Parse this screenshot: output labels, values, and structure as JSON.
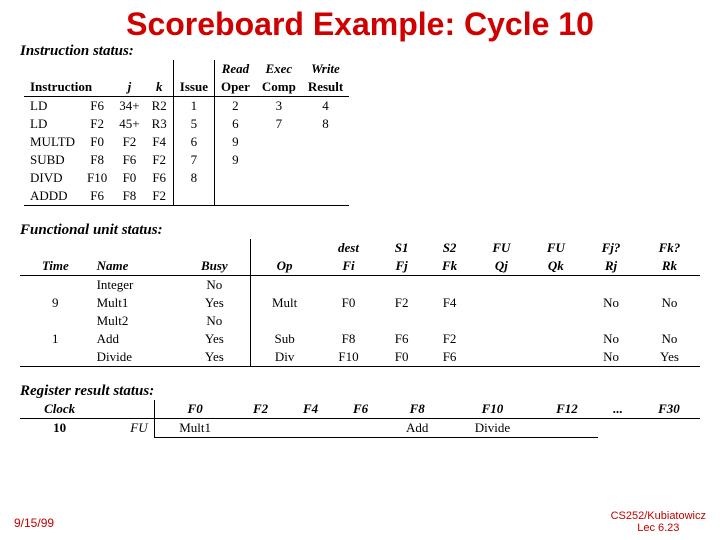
{
  "title": "Scoreboard Example: Cycle 10",
  "sections": {
    "instr": "Instruction status:",
    "fu": "Functional unit status:",
    "reg": "Register result status:"
  },
  "instr_headers": {
    "instruction": "Instruction",
    "j": "j",
    "k": "k",
    "issue": "Issue",
    "read": "Read",
    "oper": "Oper",
    "exec": "Exec",
    "comp": "Comp",
    "write": "Write",
    "result": "Result"
  },
  "instr_rows": [
    {
      "op": "LD",
      "dest": "F6",
      "j": "34+",
      "k": "R2",
      "issue": "1",
      "read": "2",
      "exec": "3",
      "write": "4"
    },
    {
      "op": "LD",
      "dest": "F2",
      "j": "45+",
      "k": "R3",
      "issue": "5",
      "read": "6",
      "exec": "7",
      "write": "8"
    },
    {
      "op": "MULTD",
      "dest": "F0",
      "j": "F2",
      "k": "F4",
      "issue": "6",
      "read": "9",
      "exec": "",
      "write": ""
    },
    {
      "op": "SUBD",
      "dest": "F8",
      "j": "F6",
      "k": "F2",
      "issue": "7",
      "read": "9",
      "exec": "",
      "write": ""
    },
    {
      "op": "DIVD",
      "dest": "F10",
      "j": "F0",
      "k": "F6",
      "issue": "8",
      "read": "",
      "exec": "",
      "write": ""
    },
    {
      "op": "ADDD",
      "dest": "F6",
      "j": "F8",
      "k": "F2",
      "issue": "",
      "read": "",
      "exec": "",
      "write": ""
    }
  ],
  "fu_headers": {
    "time": "Time",
    "name": "Name",
    "busy": "Busy",
    "op": "Op",
    "dest": "dest",
    "fi": "Fi",
    "s1": "S1",
    "fj": "Fj",
    "s2": "S2",
    "fk": "Fk",
    "fu1": "FU",
    "qj": "Qj",
    "fu2": "FU",
    "qk": "Qk",
    "fjq": "Fj?",
    "rj": "Rj",
    "fkq": "Fk?",
    "rk": "Rk"
  },
  "fu_rows": [
    {
      "time": "",
      "name": "Integer",
      "busy": "No",
      "op": "",
      "fi": "",
      "fj": "",
      "fk": "",
      "qj": "",
      "qk": "",
      "rj": "",
      "rk": ""
    },
    {
      "time": "9",
      "name": "Mult1",
      "busy": "Yes",
      "op": "Mult",
      "fi": "F0",
      "fj": "F2",
      "fk": "F4",
      "qj": "",
      "qk": "",
      "rj": "No",
      "rk": "No"
    },
    {
      "time": "",
      "name": "Mult2",
      "busy": "No",
      "op": "",
      "fi": "",
      "fj": "",
      "fk": "",
      "qj": "",
      "qk": "",
      "rj": "",
      "rk": ""
    },
    {
      "time": "1",
      "name": "Add",
      "busy": "Yes",
      "op": "Sub",
      "fi": "F8",
      "fj": "F6",
      "fk": "F2",
      "qj": "",
      "qk": "",
      "rj": "No",
      "rk": "No"
    },
    {
      "time": "",
      "name": "Divide",
      "busy": "Yes",
      "op": "Div",
      "fi": "F10",
      "fj": "F0",
      "fk": "F6",
      "qj": "",
      "qk": "",
      "rj": "No",
      "rk": "Yes"
    }
  ],
  "reg_headers": {
    "clock": "Clock",
    "fu": "FU",
    "r": [
      "F0",
      "F2",
      "F4",
      "F6",
      "F8",
      "F10",
      "F12",
      "...",
      "F30"
    ]
  },
  "reg_row": {
    "clock": "10",
    "vals": [
      "Mult1",
      "",
      "",
      "",
      "Add",
      "Divide",
      "",
      "",
      ""
    ]
  },
  "footer": {
    "date": "9/15/99",
    "right1": "CS252/Kubiatowicz",
    "right2": "Lec 6.23"
  },
  "chart_data": {
    "type": "table",
    "title": "Scoreboard Example: Cycle 10",
    "instruction_status": [
      {
        "instruction": "LD F6 34+ R2",
        "issue": 1,
        "read_oper": 2,
        "exec_comp": 3,
        "write_result": 4
      },
      {
        "instruction": "LD F2 45+ R3",
        "issue": 5,
        "read_oper": 6,
        "exec_comp": 7,
        "write_result": 8
      },
      {
        "instruction": "MULTD F0 F2 F4",
        "issue": 6,
        "read_oper": 9,
        "exec_comp": null,
        "write_result": null
      },
      {
        "instruction": "SUBD F8 F6 F2",
        "issue": 7,
        "read_oper": 9,
        "exec_comp": null,
        "write_result": null
      },
      {
        "instruction": "DIVD F10 F0 F6",
        "issue": 8,
        "read_oper": null,
        "exec_comp": null,
        "write_result": null
      },
      {
        "instruction": "ADDD F6 F8 F2",
        "issue": null,
        "read_oper": null,
        "exec_comp": null,
        "write_result": null
      }
    ],
    "functional_unit_status": [
      {
        "time": null,
        "name": "Integer",
        "busy": "No"
      },
      {
        "time": 9,
        "name": "Mult1",
        "busy": "Yes",
        "op": "Mult",
        "Fi": "F0",
        "Fj": "F2",
        "Fk": "F4",
        "Rj": "No",
        "Rk": "No"
      },
      {
        "time": null,
        "name": "Mult2",
        "busy": "No"
      },
      {
        "time": 1,
        "name": "Add",
        "busy": "Yes",
        "op": "Sub",
        "Fi": "F8",
        "Fj": "F6",
        "Fk": "F2",
        "Rj": "No",
        "Rk": "No"
      },
      {
        "time": null,
        "name": "Divide",
        "busy": "Yes",
        "op": "Div",
        "Fi": "F10",
        "Fj": "F0",
        "Fk": "F6",
        "Rj": "No",
        "Rk": "Yes"
      }
    ],
    "register_result_status": {
      "clock": 10,
      "F0": "Mult1",
      "F8": "Add",
      "F10": "Divide"
    }
  }
}
